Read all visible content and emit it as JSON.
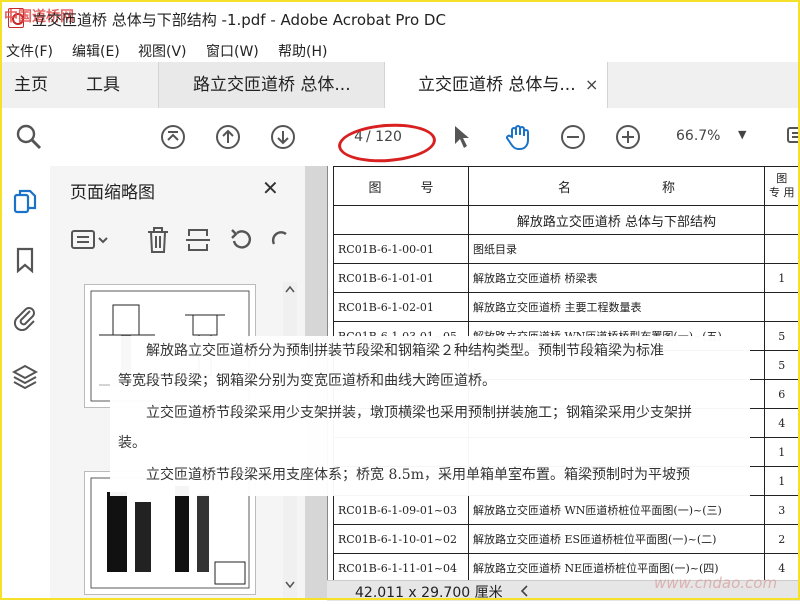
{
  "window": {
    "title": "立交匝道桥 总体与下部结构 -1.pdf - Adobe Acrobat Pro DC",
    "watermark_top": "中国道桥网",
    "watermark_bottom": "www.cndao.com"
  },
  "menu": [
    "文件(F)",
    "编辑(E)",
    "视图(V)",
    "窗口(W)",
    "帮助(H)"
  ],
  "tabs": {
    "home": "主页",
    "tools": "工具",
    "doc1": "路立交匝道桥 总体...",
    "doc2": "立交匝道桥 总体与...",
    "close": "×"
  },
  "toolbar": {
    "page_current": "4",
    "page_total": "/ 120",
    "zoom": "66.7%",
    "zoom_caret": "▼",
    "icons": [
      "search-icon",
      "page-first-icon",
      "page-up-icon",
      "page-down-icon",
      "select-arrow-icon",
      "hand-icon",
      "zoom-out-icon",
      "zoom-in-icon",
      "comment-icon"
    ]
  },
  "panel": {
    "title": "页面缩略图",
    "close": "✕"
  },
  "document": {
    "header": {
      "col1": "图　　　号",
      "col2": "名　　　　　　　称",
      "col3_top": "图",
      "col3_bottom": "专 用"
    },
    "section_title": "解放路立交匝道桥 总体与下部结构",
    "rows": [
      {
        "code": "RC01B-6-1-00-01",
        "name": "图纸目录",
        "n": ""
      },
      {
        "code": "RC01B-6-1-01-01",
        "name": "解放路立交匝道桥 桥梁表",
        "n": "1"
      },
      {
        "code": "RC01B-6-1-02-01",
        "name": "解放路立交匝道桥 主要工程数量表",
        "n": ""
      },
      {
        "code": "RC01B-6-1-03-01~05",
        "name": "解放路立交匝道桥 WN匝道桥桥型布置图(一)~(五)",
        "n": "5"
      },
      {
        "code": "",
        "name": "",
        "n": "5"
      },
      {
        "code": "",
        "name": "",
        "n": "6"
      },
      {
        "code": "",
        "name": "",
        "n": "4"
      },
      {
        "code": "",
        "name": "",
        "n": "1"
      },
      {
        "code": "",
        "name": "",
        "n": "1"
      },
      {
        "code": "RC01B-6-1-09-01~03",
        "name": "解放路立交匝道桥 WN匝道桥桩位平面图(一)~(三)",
        "n": "3"
      },
      {
        "code": "RC01B-6-1-10-01~02",
        "name": "解放路立交匝道桥 ES匝道桥桩位平面图(一)~(二)",
        "n": "2"
      },
      {
        "code": "RC01B-6-1-11-01~04",
        "name": "解放路立交匝道桥 NE匝道桥桩位平面图(一)~(四)",
        "n": "4"
      }
    ]
  },
  "overlay": {
    "line1": "　　解放路立交匝道桥分为预制拼装节段梁和钢箱梁２种结构类型。预制节段箱梁为标准",
    "line2": "等宽段节段梁；钢箱梁分别为变宽匝道桥和曲线大跨匝道桥。",
    "line3": "　　立交匝道桥节段梁采用少支架拼装，墩顶横梁也采用预制拼装施工；钢箱梁采用少支架拼",
    "line4": "装。",
    "line5": "　　立交匝道桥节段梁采用支座体系；桥宽 8.5m，采用单箱单室布置。箱梁预制时为平坡预"
  },
  "status": {
    "page_size": "42.011 x 29.700 厘米"
  },
  "colors": {
    "accent_red": "#d92020",
    "frame_yellow": "#f5e12a",
    "hand_blue": "#1a73c9"
  }
}
